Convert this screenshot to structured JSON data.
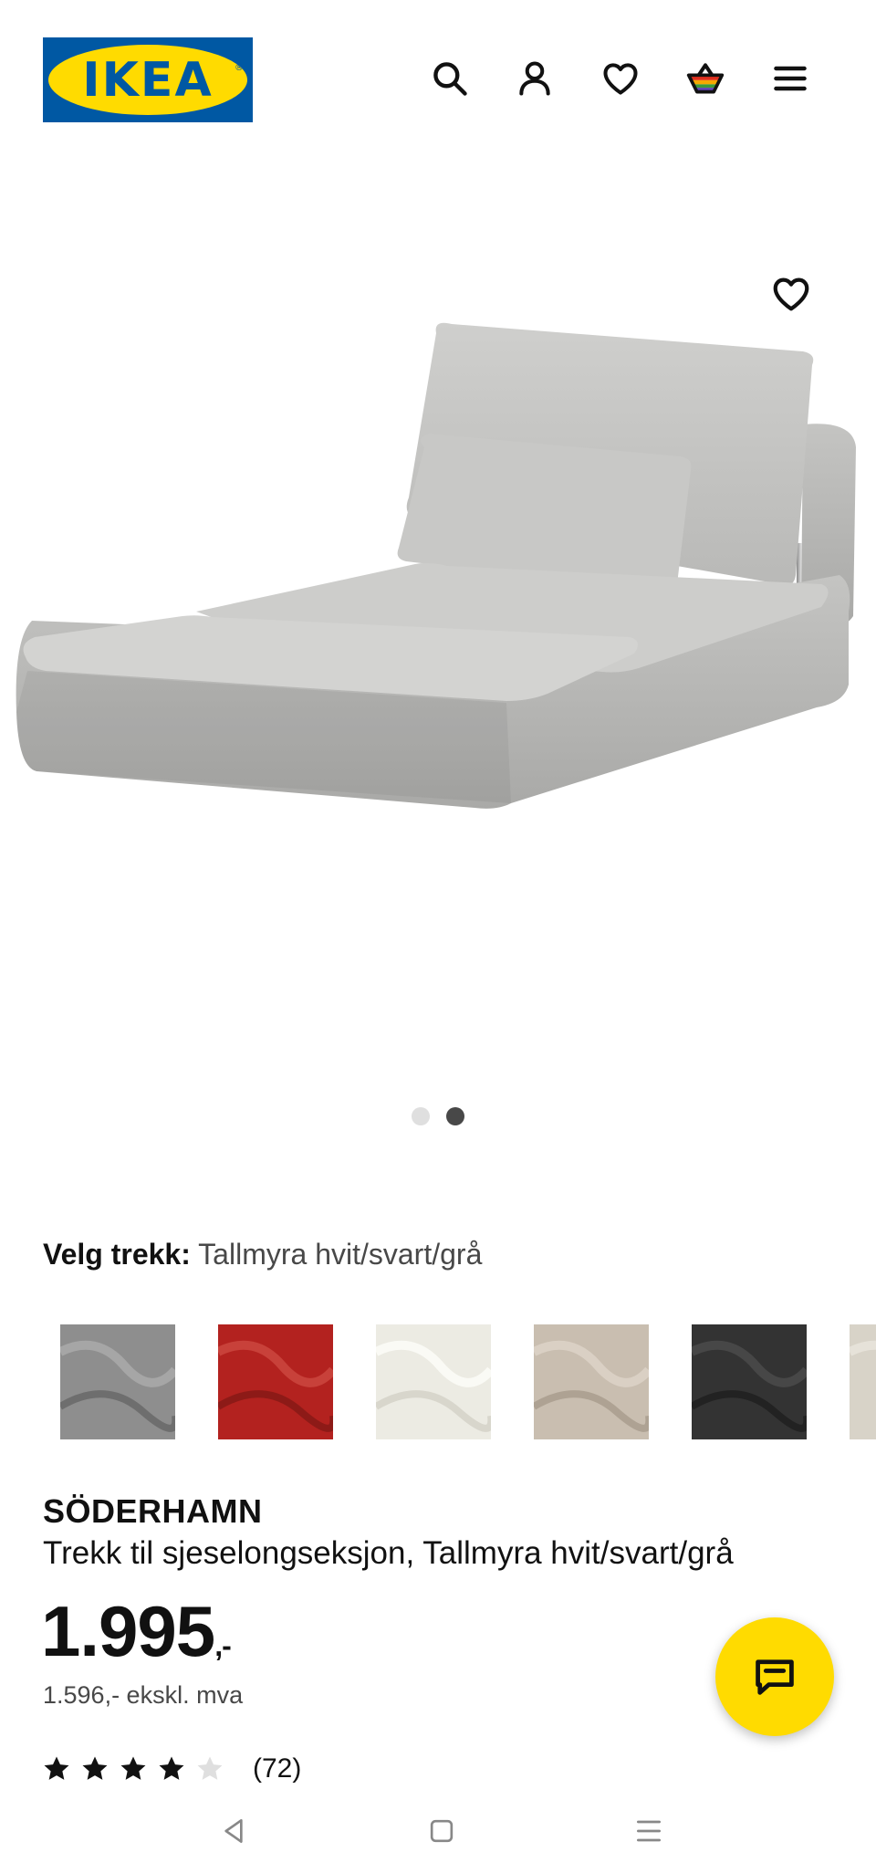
{
  "header": {
    "logo_text": "IKEA",
    "icons": [
      "search-icon",
      "account-icon",
      "heart-icon",
      "cart-icon",
      "menu-icon"
    ],
    "brand_blue": "#0058a3",
    "brand_yellow": "#ffdb00"
  },
  "gallery": {
    "favorite_icon": "heart-icon",
    "image_count": 2,
    "active_index": 1
  },
  "fabric": {
    "label": "Velg trekk:",
    "value": "Tallmyra hvit/svart/grå",
    "swatches": [
      {
        "color": "#8e8e8e"
      },
      {
        "color": "#b3221f"
      },
      {
        "color": "#ecebe3"
      },
      {
        "color": "#c9beb0"
      },
      {
        "color": "#333333"
      },
      {
        "color": "#d8d3c8"
      }
    ]
  },
  "product": {
    "name": "SÖDERHAMN",
    "description": "Trekk til sjeselongseksjon, Tallmyra hvit/svart/grå",
    "price_main": "1.995",
    "price_suffix": ",-",
    "price_ex_vat": "1.596,- ekskl. mva",
    "rating_value": 4,
    "rating_max": 5,
    "rating_count": "(72)"
  },
  "chat": {
    "icon": "chat-icon",
    "color": "#ffdb00"
  },
  "system_nav": {
    "icons": [
      "back-icon",
      "home-icon",
      "recents-icon"
    ]
  }
}
